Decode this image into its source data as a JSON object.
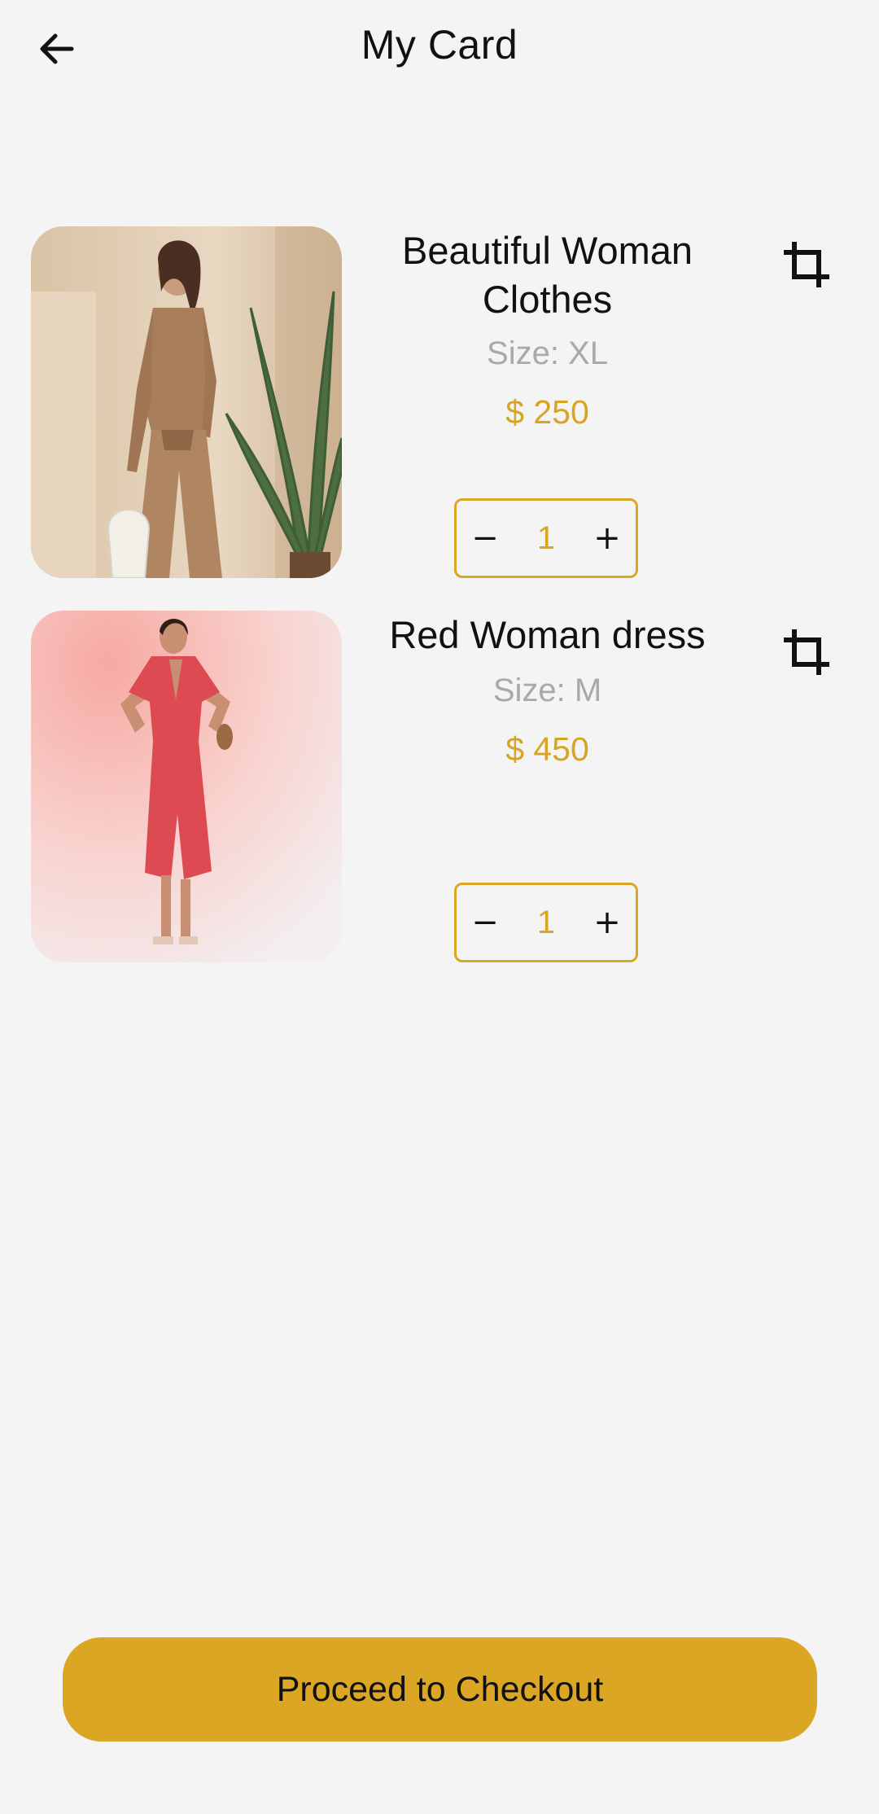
{
  "header": {
    "title": "My Card",
    "back_icon": "arrow-left-icon"
  },
  "cart": {
    "items": [
      {
        "name": "Beautiful Woman Clothes",
        "size": "Size: XL",
        "price": "$ 250",
        "quantity": "1",
        "decrement": "−",
        "increment": "+",
        "remove_icon": "crop-icon",
        "image": "beige-outfit-photo"
      },
      {
        "name": "Red Woman dress",
        "size": "Size: M",
        "price": "$ 450",
        "quantity": "1",
        "decrement": "−",
        "increment": "+",
        "remove_icon": "crop-icon",
        "image": "red-dress-photo"
      }
    ]
  },
  "footer": {
    "checkout_label": "Proceed to Checkout"
  },
  "colors": {
    "accent": "#dba623",
    "price": "#d7a523",
    "background": "#f4f4f4",
    "muted": "#a9a9a9"
  }
}
